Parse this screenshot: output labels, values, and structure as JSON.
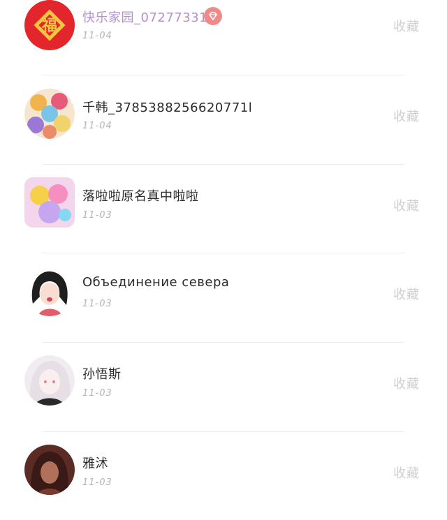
{
  "users": [
    {
      "name": "快乐家园_072773318",
      "date": "11-04",
      "action": "收藏",
      "vip": true,
      "avatar_icon": "fu-character-icon",
      "accent": "#b58fcf"
    },
    {
      "name": "千韩_3785388256620771l",
      "date": "11-04",
      "action": "收藏",
      "vip": false,
      "avatar_icon": "anime-group-avatar"
    },
    {
      "name": "落啦啦原名真中啦啦",
      "date": "11-03",
      "action": "收藏",
      "vip": false,
      "avatar_icon": "anime-girls-avatar"
    },
    {
      "name": "Объединение севера",
      "date": "11-03",
      "action": "收藏",
      "vip": false,
      "avatar_icon": "dark-hair-girl-avatar"
    },
    {
      "name": "孙悟斯",
      "date": "11-03",
      "action": "收藏",
      "vip": false,
      "avatar_icon": "white-hair-girl-avatar"
    },
    {
      "name": "雅沭",
      "date": "11-03",
      "action": "收藏",
      "vip": false,
      "avatar_icon": "brown-portrait-avatar"
    }
  ],
  "colors": {
    "vip_badge": "#f08a8a",
    "fu_red": "#e3262b",
    "fu_gold": "#f3c63f"
  }
}
